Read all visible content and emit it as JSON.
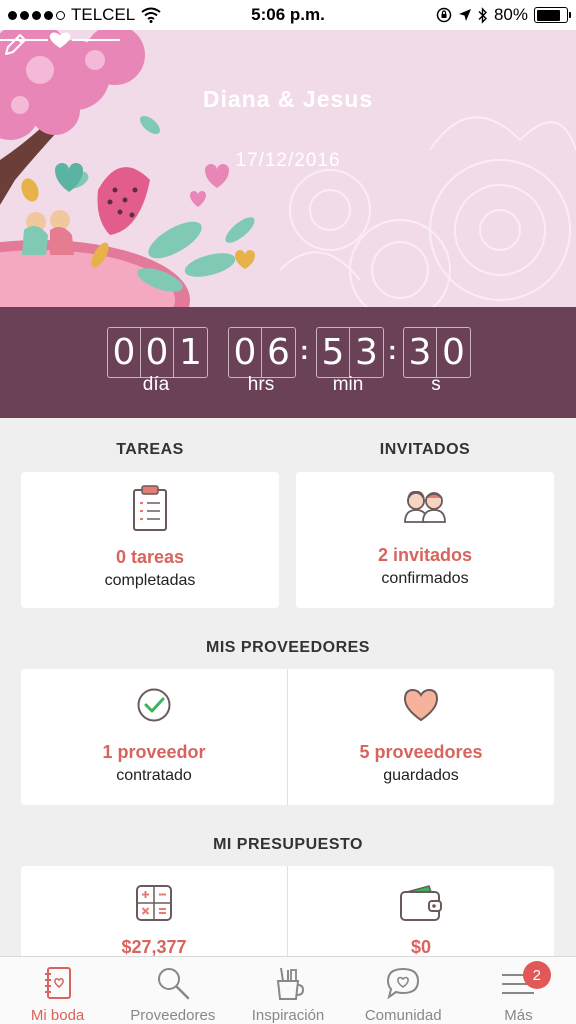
{
  "status_bar": {
    "carrier": "TELCEL",
    "time": "5:06 p.m.",
    "battery_percent": "80%",
    "battery_level": 0.8
  },
  "hero": {
    "couple_names": "Diana & Jesus",
    "wedding_date": "17/12/2016"
  },
  "countdown": {
    "days_digits": [
      "0",
      "0",
      "1"
    ],
    "hours_digits": [
      "0",
      "6"
    ],
    "minutes_digits": [
      "5",
      "3"
    ],
    "seconds_digits": [
      "3",
      "0"
    ],
    "days_label": "día",
    "hours_label": "hrs",
    "minutes_label": "min",
    "seconds_label": "s",
    "separator": ":"
  },
  "tasks": {
    "title": "TAREAS",
    "value": "0 tareas",
    "sub": "completadas",
    "icon": "clipboard-checklist-icon"
  },
  "guests": {
    "title": "INVITADOS",
    "value": "2 invitados",
    "sub": "confirmados",
    "icon": "couple-guests-icon"
  },
  "vendors": {
    "title": "MIS PROVEEDORES",
    "hired_value": "1 proveedor",
    "hired_sub": "contratado",
    "saved_value": "5 proveedores",
    "saved_sub": "guardados"
  },
  "budget": {
    "title": "MI PRESUPUESTO",
    "estimated_value": "$27,377",
    "spent_value": "$0"
  },
  "tab_bar": {
    "tabs": [
      {
        "label": "Mi boda",
        "icon": "notebook-icon",
        "active": true
      },
      {
        "label": "Proveedores",
        "icon": "search-icon",
        "active": false
      },
      {
        "label": "Inspiración",
        "icon": "pencil-cup-icon",
        "active": false
      },
      {
        "label": "Comunidad",
        "icon": "heart-chat-icon",
        "active": false
      },
      {
        "label": "Más",
        "icon": "menu-icon",
        "active": false
      }
    ],
    "more_badge": "2"
  },
  "colors": {
    "accent": "#d9645d",
    "countdown_bg": "#6b4158",
    "hero_bg": "#f2dbe9"
  }
}
